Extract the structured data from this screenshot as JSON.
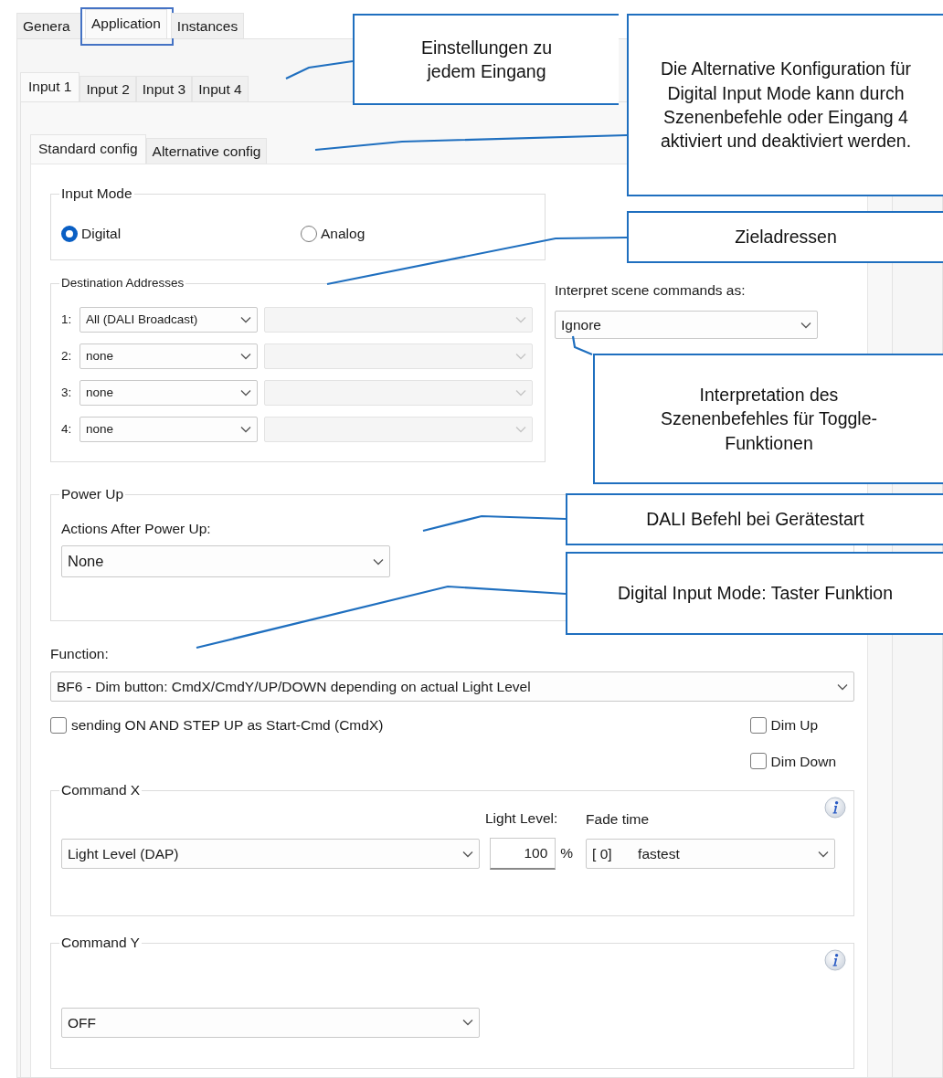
{
  "top_tabs": [
    {
      "label": "Genera",
      "selected": false,
      "highlighted": false
    },
    {
      "label": "Application",
      "selected": true,
      "highlighted": true
    },
    {
      "label": "Instances",
      "selected": false,
      "highlighted": false
    }
  ],
  "input_tabs": [
    {
      "label": "Input 1",
      "selected": true
    },
    {
      "label": "Input 2",
      "selected": false
    },
    {
      "label": "Input 3",
      "selected": false
    },
    {
      "label": "Input 4",
      "selected": false
    }
  ],
  "config_tabs": [
    {
      "label": "Standard config",
      "selected": true
    },
    {
      "label": "Alternative config",
      "selected": false
    }
  ],
  "input_mode": {
    "title": "Input Mode",
    "options": [
      {
        "label": "Digital",
        "selected": true
      },
      {
        "label": "Analog",
        "selected": false
      }
    ]
  },
  "destination_addresses": {
    "title": "Destination Addresses",
    "rows": [
      {
        "index": "1:",
        "value": "All (DALI Broadcast)",
        "detail_disabled": true
      },
      {
        "index": "2:",
        "value": "none",
        "detail_disabled": true
      },
      {
        "index": "3:",
        "value": "none",
        "detail_disabled": true
      },
      {
        "index": "4:",
        "value": "none",
        "detail_disabled": true
      }
    ]
  },
  "scene_commands": {
    "label": "Interpret scene commands as:",
    "value": "Ignore"
  },
  "power_up": {
    "title": "Power Up",
    "label": "Actions After Power Up:",
    "value": "None"
  },
  "function": {
    "label": "Function:",
    "value": "BF6 - Dim button:  CmdX/CmdY/UP/DOWN depending on actual Light Level"
  },
  "options": [
    {
      "label": "sending ON AND STEP UP as Start-Cmd (CmdX)",
      "checked": false
    },
    {
      "label": "Dim Up",
      "checked": false
    },
    {
      "label": "Dim Down",
      "checked": false
    }
  ],
  "command_x": {
    "title": "Command X",
    "command": "Light Level (DAP)",
    "light_level_label": "Light Level:",
    "light_level": "100",
    "unit": "%",
    "fade_label": "Fade time",
    "fade_code": "[ 0]",
    "fade_value": "fastest"
  },
  "command_y": {
    "title": "Command Y",
    "command": "OFF"
  },
  "callouts": [
    {
      "text": "Einstellungen zu jedem Eingang"
    },
    {
      "text": "Die Alternative Konfiguration für Digital Input Mode kann durch Szenenbefehle oder Eingang 4 aktiviert und deaktiviert werden."
    },
    {
      "text": "Zieladressen"
    },
    {
      "text": "Interpretation des Szenenbefehles für Toggle-Funktionen"
    },
    {
      "text": "DALI Befehl bei Gerätestart"
    },
    {
      "text": "Digital Input Mode: Taster Funktion"
    }
  ]
}
